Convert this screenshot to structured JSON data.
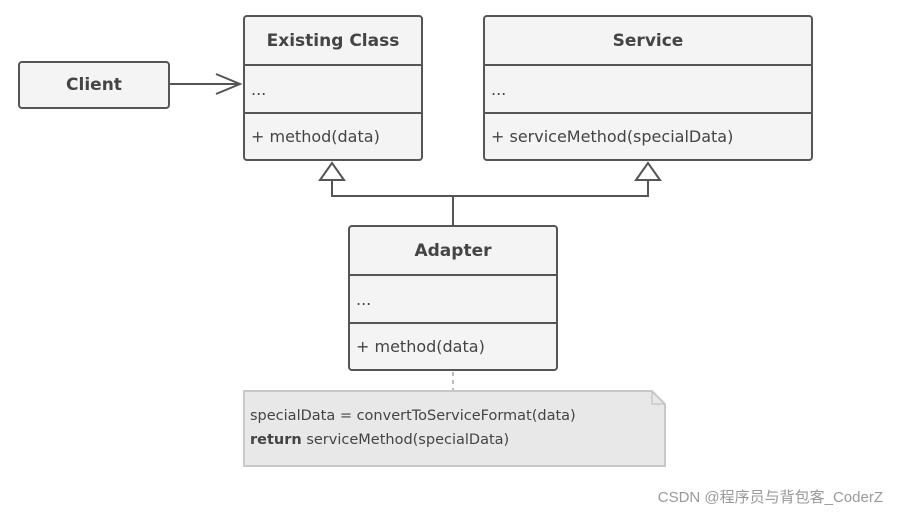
{
  "diagram": {
    "type": "UML class diagram - Adapter pattern",
    "client": {
      "label": "Client"
    },
    "existing_class": {
      "title": "Existing Class",
      "fields": "...",
      "methods": "+ method(data)"
    },
    "service": {
      "title": "Service",
      "fields": "...",
      "methods": "+ serviceMethod(specialData)"
    },
    "adapter": {
      "title": "Adapter",
      "fields": "...",
      "methods": "+ method(data)"
    },
    "note": {
      "line1": "specialData = convertToServiceFormat(data)",
      "line2_keyword": "return",
      "line2_rest": " serviceMethod(specialData)"
    },
    "relations": [
      {
        "from": "Client",
        "to": "Existing Class",
        "kind": "association"
      },
      {
        "from": "Adapter",
        "to": "Existing Class",
        "kind": "inheritance"
      },
      {
        "from": "Adapter",
        "to": "Service",
        "kind": "inheritance"
      },
      {
        "from": "Note",
        "to": "Adapter",
        "kind": "note-link"
      }
    ]
  },
  "watermark": "CSDN @程序员与背包客_CoderZ",
  "colors": {
    "stroke": "#555555",
    "fill": "#f4f4f4",
    "note_fill": "#e8e8e8",
    "note_stroke": "#c8c8c8"
  }
}
